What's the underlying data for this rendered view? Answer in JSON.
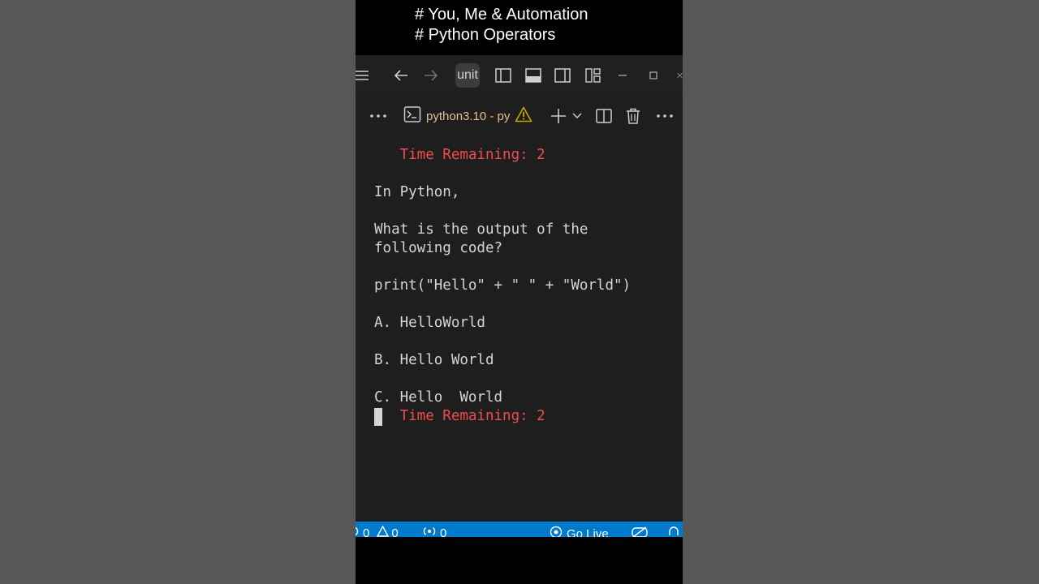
{
  "caption": {
    "line1": "# You, Me & Automation",
    "line2": "# Python Operators"
  },
  "titlebar": {
    "search_text": "unit",
    "icons": [
      "menu-icon",
      "back-arrow-icon",
      "forward-arrow-icon",
      "toggle-primary-sidebar-icon",
      "toggle-panel-icon",
      "toggle-secondary-sidebar-icon",
      "customize-layout-icon",
      "minimize-icon",
      "maximize-icon",
      "close-icon"
    ]
  },
  "panel": {
    "terminal_name": "python3.10 - py",
    "icons": [
      "more-icon",
      "terminal-icon",
      "warning-icon",
      "plus-icon",
      "chevron-down-icon",
      "split-icon",
      "trash-icon",
      "more-icon"
    ]
  },
  "terminal": {
    "lines": [
      {
        "text": "   Time Remaining: 2",
        "color": "red"
      },
      {
        "text": "In Python,",
        "color": "default"
      },
      {
        "text": "What is the output of the",
        "color": "default"
      },
      {
        "text": "following code?",
        "color": "default"
      },
      {
        "text": "print(\"Hello\" + \" \" + \"World\")",
        "color": "default"
      },
      {
        "text": "A. HelloWorld",
        "color": "default"
      },
      {
        "text": "B. Hello World",
        "color": "default"
      },
      {
        "text": "C. Hello  World",
        "color": "default"
      },
      {
        "text": "   Time Remaining: 2",
        "color": "red"
      }
    ]
  },
  "statusbar": {
    "errors": "0",
    "warnings": "0",
    "ports": "0",
    "go_live": "Go Live"
  },
  "colors": {
    "accent": "#007acc",
    "terminal_red": "#f14c4c",
    "terminal_name": "#e2c08d",
    "warning": "#cca700"
  }
}
